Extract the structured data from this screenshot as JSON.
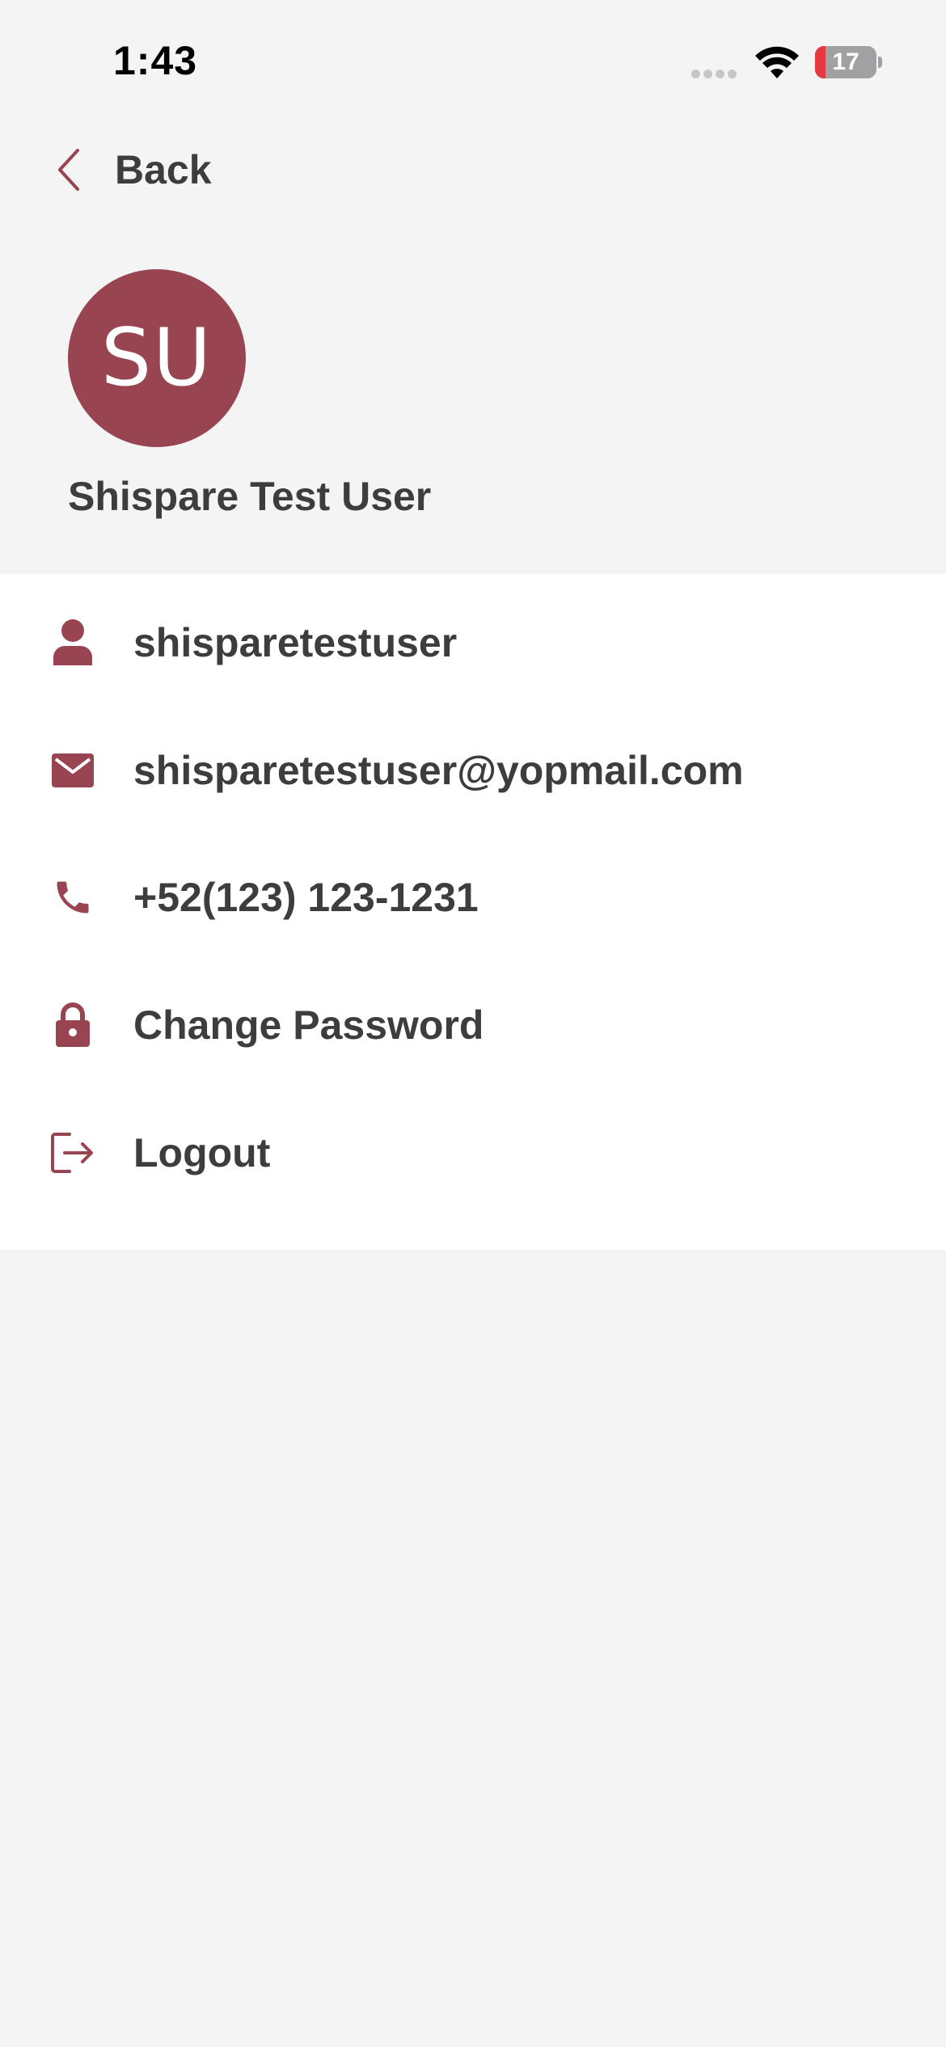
{
  "status_bar": {
    "time": "1:43",
    "battery_level": "17",
    "battery_fraction": 0.17
  },
  "header": {
    "back_label": "Back"
  },
  "profile": {
    "initials": "SU",
    "name": "Shispare Test User"
  },
  "menu": {
    "items": [
      {
        "icon": "person-icon",
        "label": "shisparetestuser"
      },
      {
        "icon": "mail-icon",
        "label": "shisparetestuser@yopmail.com"
      },
      {
        "icon": "phone-icon",
        "label": "+52(123) 123-1231"
      },
      {
        "icon": "lock-icon",
        "label": "Change Password"
      },
      {
        "icon": "logout-icon",
        "label": "Logout"
      }
    ]
  },
  "colors": {
    "accent": "#994451",
    "text": "#3d3d3d",
    "background": "#f4f4f5",
    "card": "#ffffff",
    "battery_low": "#e5393f"
  }
}
